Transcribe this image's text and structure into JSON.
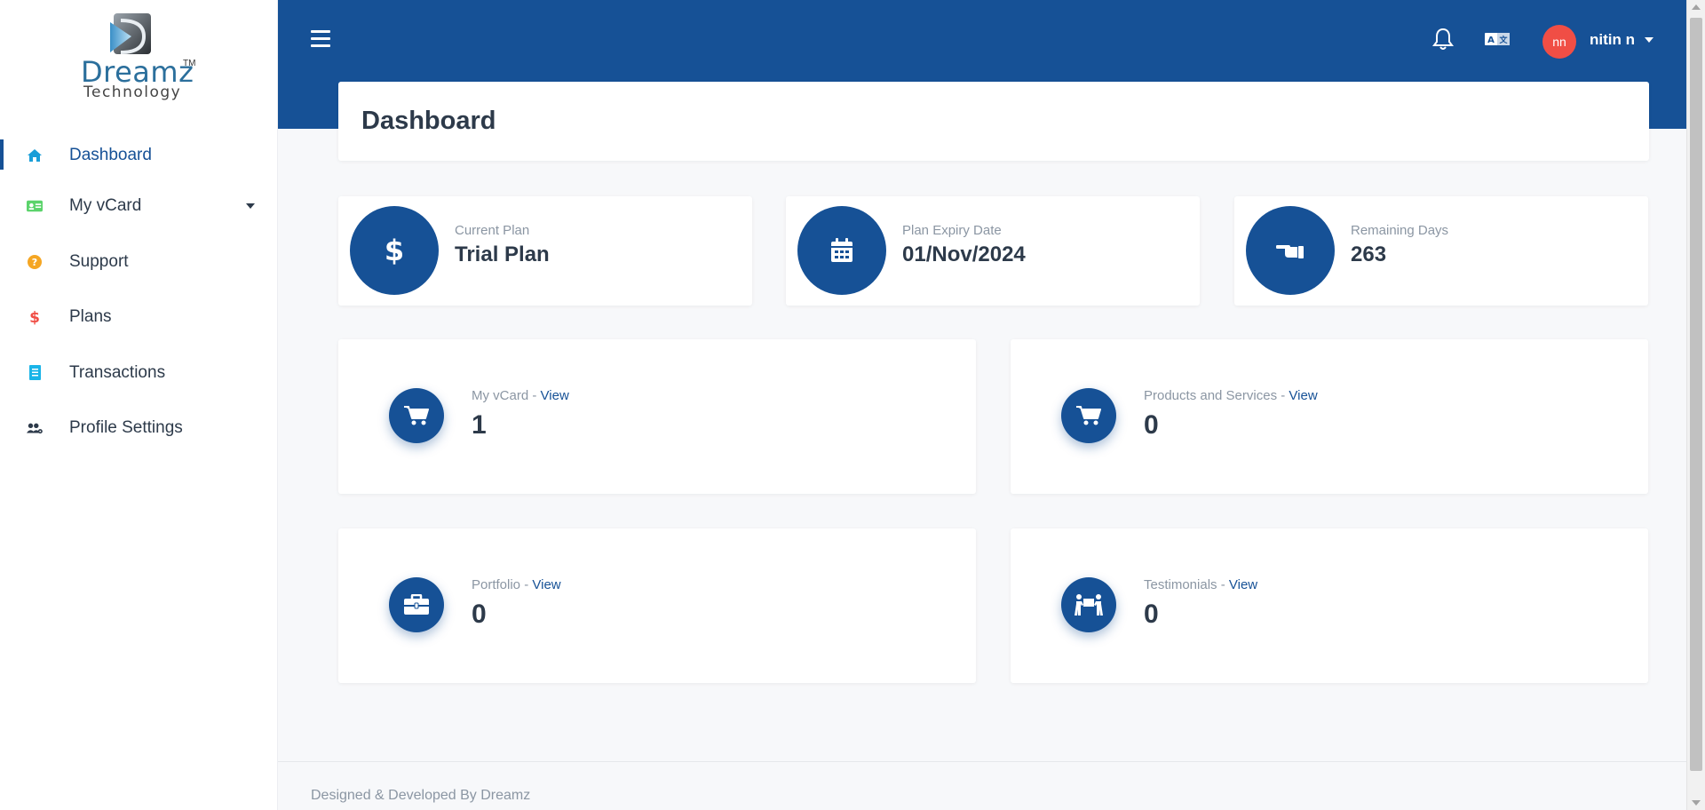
{
  "brand": {
    "name": "Dreamz",
    "tm": "TM",
    "subtitle": "Technology"
  },
  "sidebar": {
    "items": [
      {
        "label": "Dashboard",
        "icon": "home-icon",
        "color": "#1a9ed8",
        "active": true
      },
      {
        "label": "My vCard",
        "icon": "id-card-icon",
        "color": "#5bd36b",
        "has_caret": true
      },
      {
        "label": "Support",
        "icon": "question-circle-icon",
        "color": "#f5a623"
      },
      {
        "label": "Plans",
        "icon": "dollar-icon",
        "color": "#f04e45"
      },
      {
        "label": "Transactions",
        "icon": "receipt-icon",
        "color": "#1ab4e8"
      },
      {
        "label": "Profile Settings",
        "icon": "users-cog-icon",
        "color": "#2d3a4a"
      }
    ]
  },
  "header": {
    "user_initials": "nn",
    "user_name": "nitin n",
    "colors": {
      "bar": "#165196",
      "avatar": "#f04e45"
    }
  },
  "page": {
    "title": "Dashboard"
  },
  "stats": [
    {
      "label": "Current Plan",
      "value": "Trial Plan",
      "icon": "dollar-icon"
    },
    {
      "label": "Plan Expiry Date",
      "value": "01/Nov/2024",
      "icon": "calendar-icon"
    },
    {
      "label": "Remaining Days",
      "value": "263",
      "icon": "hand-pointer-icon"
    }
  ],
  "counts": [
    {
      "label": "My vCard",
      "sep": " - ",
      "link": "View",
      "value": "1",
      "icon": "cart-icon"
    },
    {
      "label": "Products and Services",
      "sep": " - ",
      "link": "View",
      "value": "0",
      "icon": "cart-icon"
    },
    {
      "label": "Portfolio",
      "sep": " - ",
      "link": "View",
      "value": "0",
      "icon": "briefcase-icon"
    },
    {
      "label": "Testimonials",
      "sep": " - ",
      "link": "View",
      "value": "0",
      "icon": "people-carry-icon"
    }
  ],
  "footer": {
    "text": "Designed & Developed By Dreamz"
  }
}
